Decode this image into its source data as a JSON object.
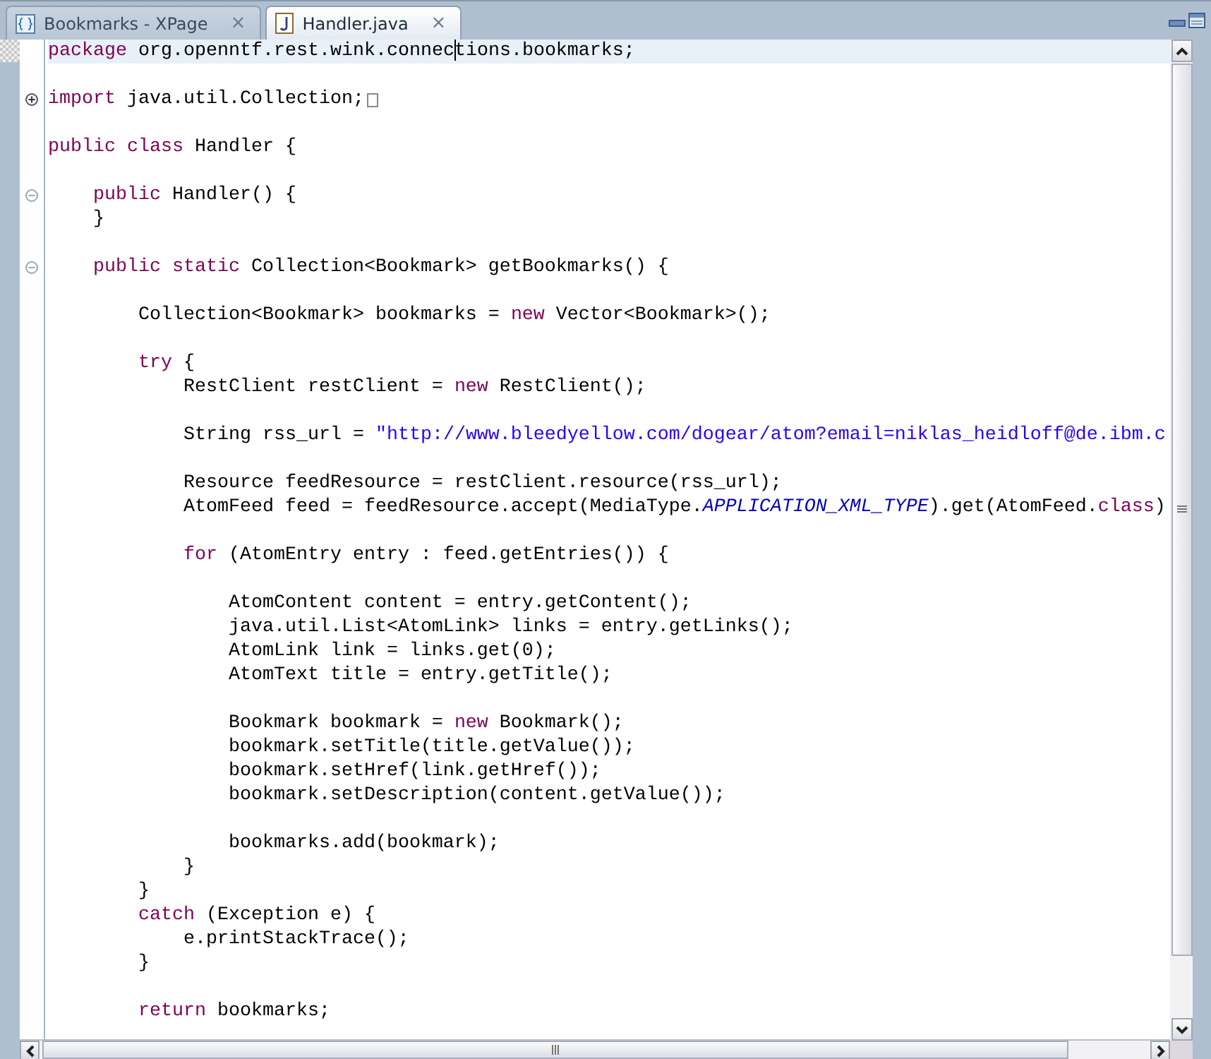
{
  "tabs": [
    {
      "label": "Bookmarks - XPage",
      "selected": false,
      "close": "×"
    },
    {
      "label": "Handler.java",
      "selected": true,
      "close": "×"
    }
  ],
  "lines": [
    {
      "kind": "code",
      "current": true,
      "tokens": [
        {
          "kind": "kw",
          "text": "package"
        },
        {
          "kind": "plain",
          "text": " org.openntf.rest.wink.connec"
        },
        {
          "kind": "caret"
        },
        {
          "kind": "plain",
          "text": "tions.bookmarks;"
        }
      ]
    },
    {
      "kind": "blank"
    },
    {
      "kind": "code",
      "current": false,
      "fold": {
        "expanded": false
      },
      "tokens": [
        {
          "kind": "kw",
          "text": "import"
        },
        {
          "kind": "plain",
          "text": " java.util.Collection;"
        }
      ]
    },
    {
      "kind": "blank"
    },
    {
      "kind": "code",
      "current": false,
      "tokens": [
        {
          "kind": "kw",
          "text": "public class"
        },
        {
          "kind": "plain",
          "text": " Handler {"
        }
      ],
      "children": [
        {
          "kind": "blank"
        },
        {
          "kind": "code",
          "current": false,
          "fold": {
            "expanded": true
          },
          "tokens": [
            {
              "kind": "kw",
              "text": "public"
            },
            {
              "kind": "plain",
              "text": " Handler() {"
            }
          ]
        },
        {
          "kind": "code",
          "current": false,
          "tokens": [
            {
              "kind": "plain",
              "text": "}"
            }
          ]
        },
        {
          "kind": "blank"
        },
        {
          "kind": "code",
          "current": false,
          "fold": {
            "expanded": true
          },
          "tokens": [
            {
              "kind": "kw",
              "text": "public static"
            },
            {
              "kind": "plain",
              "text": " Collection<Bookmark> getBookmarks() {"
            }
          ],
          "children": [
            {
              "kind": "blank"
            },
            {
              "kind": "code",
              "current": false,
              "tokens": [
                {
                  "kind": "plain",
                  "text": "Collection<Bookmark> bookmarks = "
                },
                {
                  "kind": "kw",
                  "text": "new"
                },
                {
                  "kind": "plain",
                  "text": " Vector<Bookmark>();"
                }
              ]
            },
            {
              "kind": "blank"
            },
            {
              "kind": "code",
              "current": false,
              "tokens": [
                {
                  "kind": "kw",
                  "text": "try"
                },
                {
                  "kind": "plain",
                  "text": " {"
                }
              ],
              "children": [
                {
                  "kind": "code",
                  "current": false,
                  "tokens": [
                    {
                      "kind": "plain",
                      "text": "RestClient restClient = "
                    },
                    {
                      "kind": "kw",
                      "text": "new"
                    },
                    {
                      "kind": "plain",
                      "text": " RestClient();"
                    }
                  ]
                },
                {
                  "kind": "blank"
                },
                {
                  "kind": "code",
                  "current": false,
                  "tokens": [
                    {
                      "kind": "plain",
                      "text": "String rss_url = "
                    },
                    {
                      "kind": "str",
                      "text": "\"http://www.bleedyellow.com/dogear/atom?email=niklas_heidloff@de.ibm.c"
                    }
                  ]
                },
                {
                  "kind": "blank"
                },
                {
                  "kind": "code",
                  "current": false,
                  "tokens": [
                    {
                      "kind": "plain",
                      "text": "Resource feedResource = restClient.resource(rss_url);"
                    }
                  ]
                },
                {
                  "kind": "code",
                  "current": false,
                  "tokens": [
                    {
                      "kind": "plain",
                      "text": "AtomFeed feed = feedResource.accept(MediaType."
                    },
                    {
                      "kind": "const",
                      "text": "APPLICATION_XML_TYPE"
                    },
                    {
                      "kind": "plain",
                      "text": ").get(AtomFeed."
                    },
                    {
                      "kind": "kw",
                      "text": "class"
                    },
                    {
                      "kind": "plain",
                      "text": ")"
                    }
                  ]
                },
                {
                  "kind": "blank"
                },
                {
                  "kind": "code",
                  "current": false,
                  "tokens": [
                    {
                      "kind": "kw",
                      "text": "for"
                    },
                    {
                      "kind": "plain",
                      "text": " (AtomEntry entry : feed.getEntries()) {"
                    }
                  ],
                  "children": [
                    {
                      "kind": "blank"
                    },
                    {
                      "kind": "code",
                      "current": false,
                      "tokens": [
                        {
                          "kind": "plain",
                          "text": "AtomContent content = entry.getContent();"
                        }
                      ]
                    },
                    {
                      "kind": "code",
                      "current": false,
                      "tokens": [
                        {
                          "kind": "plain",
                          "text": "java.util.List<AtomLink> links = entry.getLinks();"
                        }
                      ]
                    },
                    {
                      "kind": "code",
                      "current": false,
                      "tokens": [
                        {
                          "kind": "plain",
                          "text": "AtomLink link = links.get(0);"
                        }
                      ]
                    },
                    {
                      "kind": "code",
                      "current": false,
                      "tokens": [
                        {
                          "kind": "plain",
                          "text": "AtomText title = entry.getTitle();"
                        }
                      ]
                    },
                    {
                      "kind": "blank"
                    },
                    {
                      "kind": "code",
                      "current": false,
                      "tokens": [
                        {
                          "kind": "plain",
                          "text": "Bookmark bookmark = "
                        },
                        {
                          "kind": "kw",
                          "text": "new"
                        },
                        {
                          "kind": "plain",
                          "text": " Bookmark();"
                        }
                      ]
                    },
                    {
                      "kind": "code",
                      "current": false,
                      "tokens": [
                        {
                          "kind": "plain",
                          "text": "bookmark.setTitle(title.getValue());"
                        }
                      ]
                    },
                    {
                      "kind": "code",
                      "current": false,
                      "tokens": [
                        {
                          "kind": "plain",
                          "text": "bookmark.setHref(link.getHref());"
                        }
                      ]
                    },
                    {
                      "kind": "code",
                      "current": false,
                      "tokens": [
                        {
                          "kind": "plain",
                          "text": "bookmark.setDescription(content.getValue());"
                        }
                      ]
                    },
                    {
                      "kind": "blank"
                    },
                    {
                      "kind": "code",
                      "current": false,
                      "tokens": [
                        {
                          "kind": "plain",
                          "text": "bookmarks.add(bookmark);"
                        }
                      ]
                    }
                  ]
                },
                {
                  "kind": "code",
                  "current": false,
                  "tokens": [
                    {
                      "kind": "plain",
                      "text": "}"
                    }
                  ]
                }
              ]
            },
            {
              "kind": "code",
              "current": false,
              "tokens": [
                {
                  "kind": "plain",
                  "text": "}"
                }
              ]
            },
            {
              "kind": "code",
              "current": false,
              "tokens": [
                {
                  "kind": "kw",
                  "text": "catch"
                },
                {
                  "kind": "plain",
                  "text": " (Exception e) {"
                }
              ],
              "children": [
                {
                  "kind": "code",
                  "current": false,
                  "tokens": [
                    {
                      "kind": "plain",
                      "text": "e.printStackTrace();"
                    }
                  ]
                }
              ]
            },
            {
              "kind": "code",
              "current": false,
              "tokens": [
                {
                  "kind": "plain",
                  "text": "}"
                }
              ]
            },
            {
              "kind": "blank"
            },
            {
              "kind": "code",
              "current": false,
              "tokens": [
                {
                  "kind": "kw",
                  "text": "return"
                },
                {
                  "kind": "plain",
                  "text": " bookmarks;"
                }
              ]
            }
          ]
        }
      ]
    }
  ]
}
